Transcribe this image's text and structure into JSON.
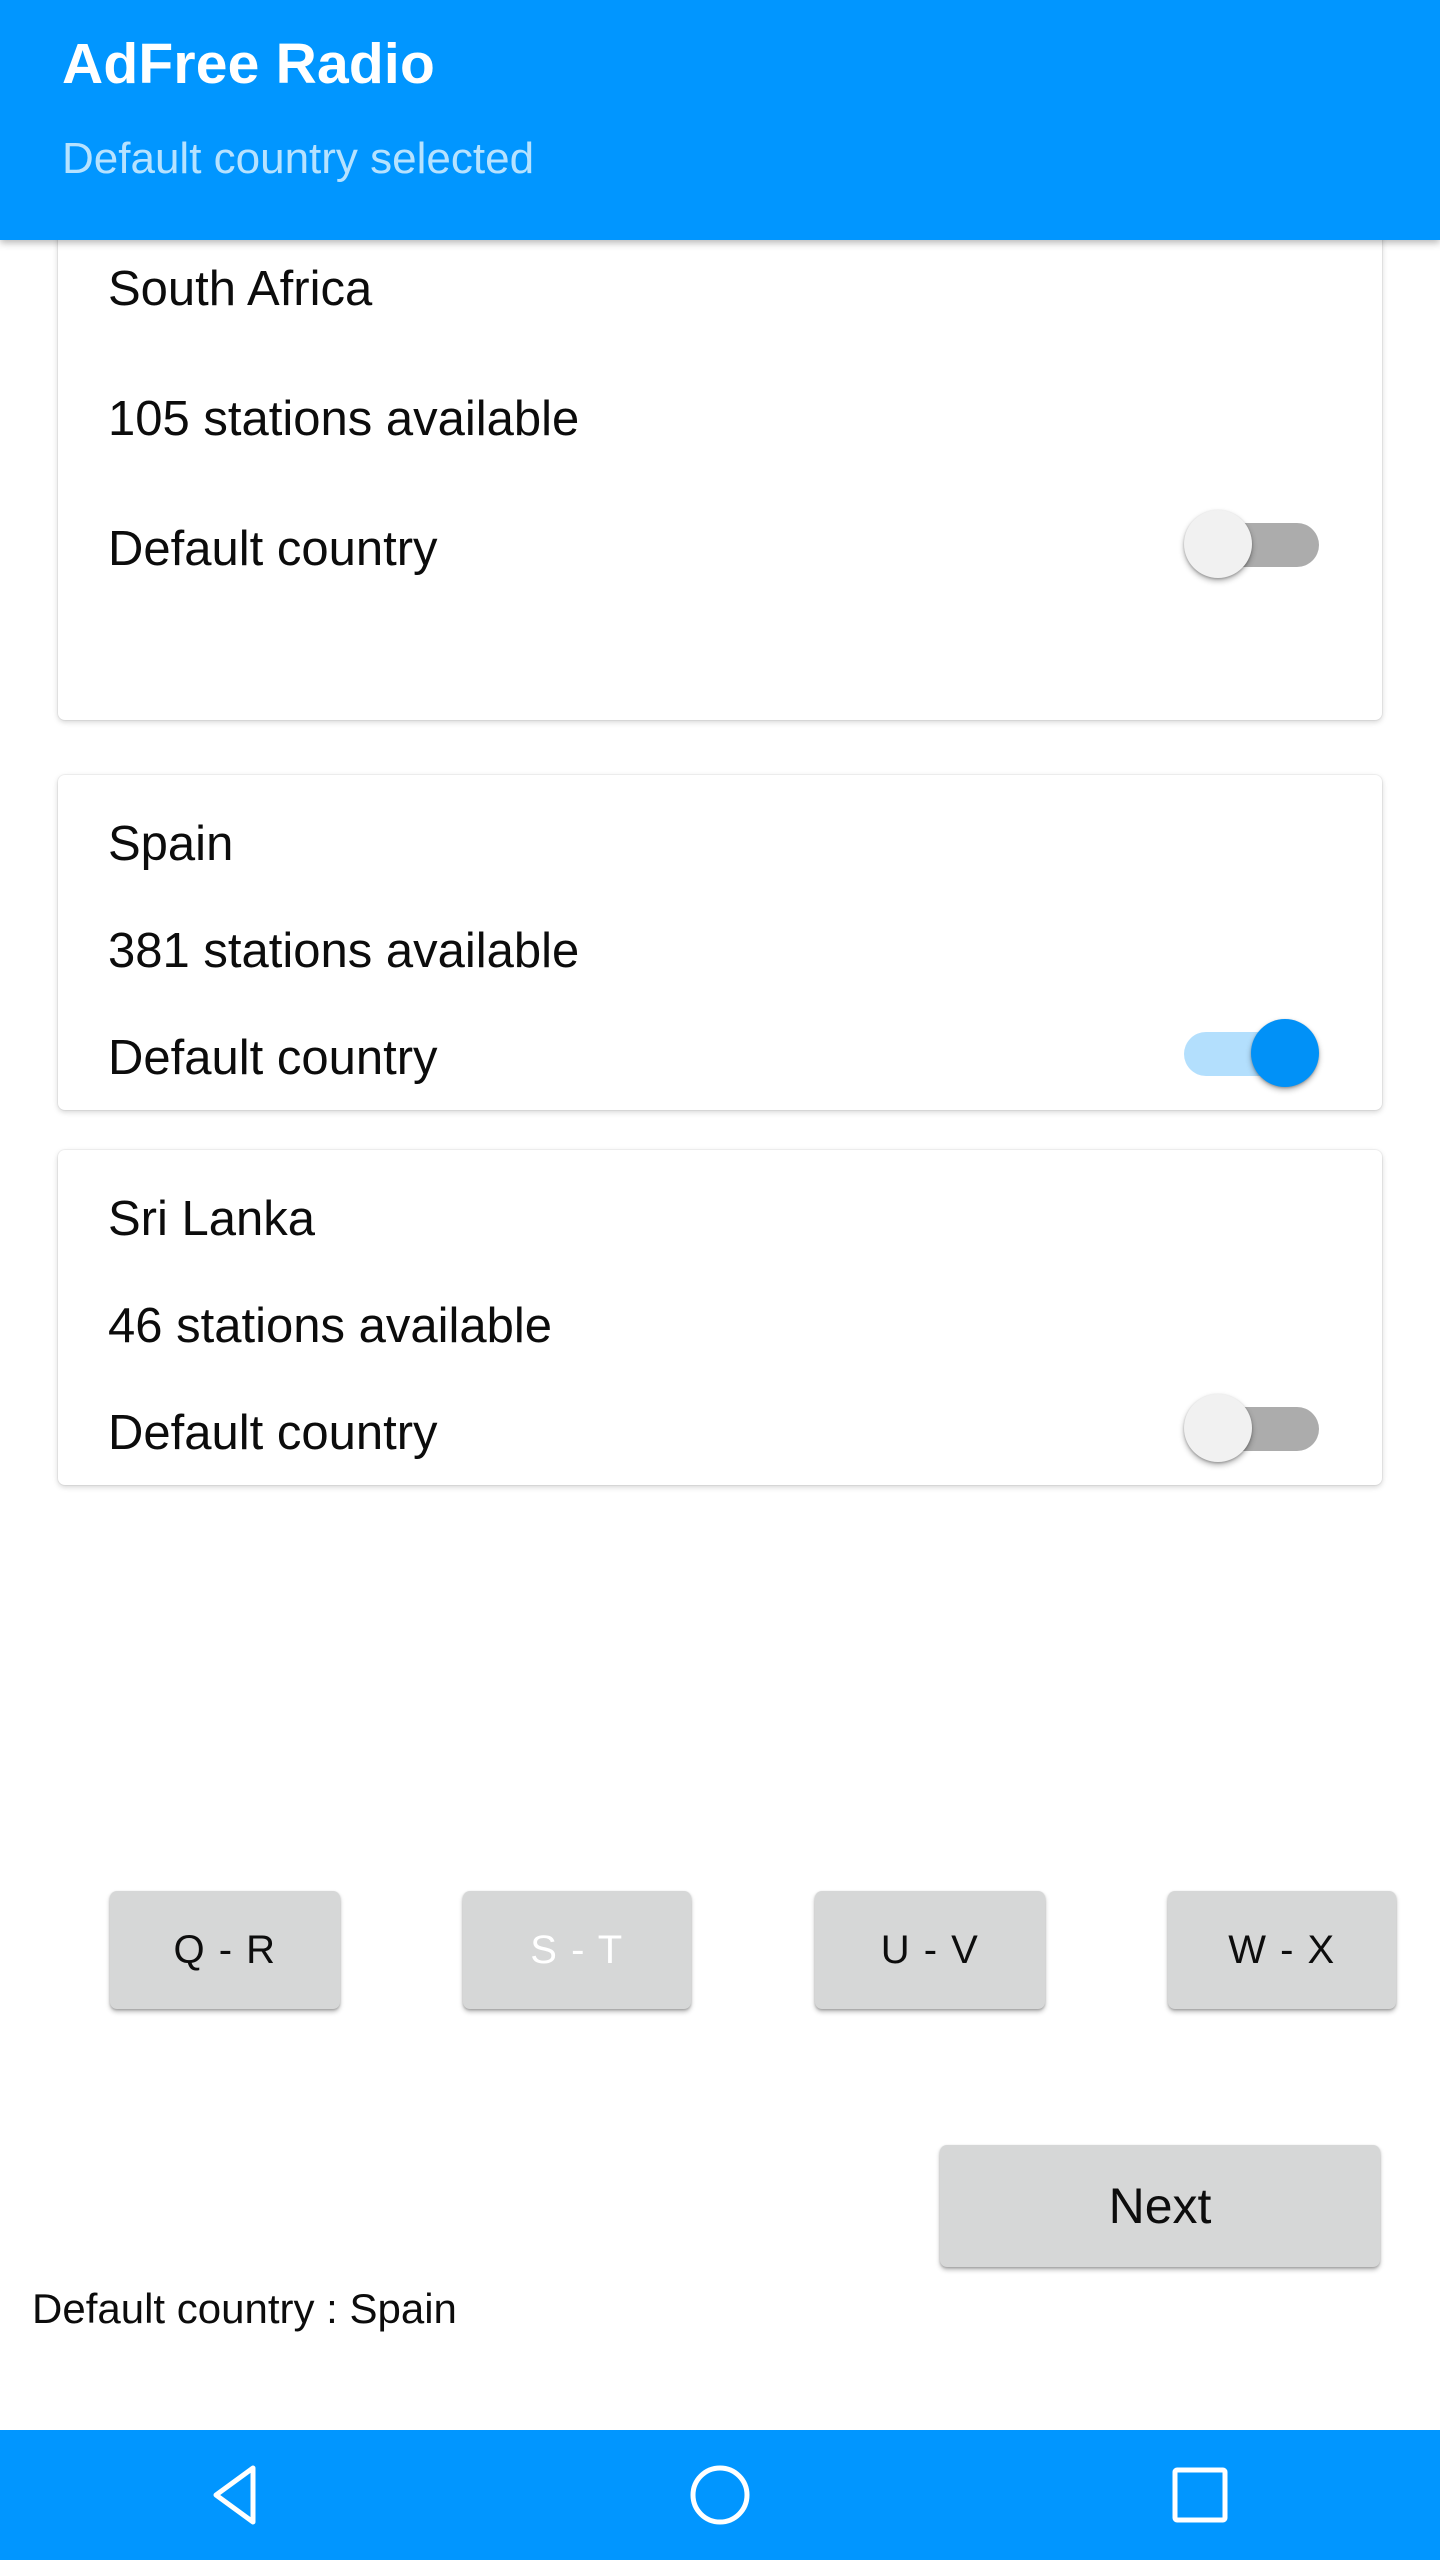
{
  "appbar": {
    "title": "AdFree Radio",
    "subtitle": "Default country selected",
    "background_color": "#0196FF",
    "subtitle_color": "#B6E2FF"
  },
  "country_cards": [
    {
      "name": "South Africa",
      "stations_text": "105 stations available",
      "stations_count": 105,
      "default_label": "Default country",
      "default_enabled": false,
      "clipped_top": true
    },
    {
      "name": "Spain",
      "stations_text": "381 stations available",
      "stations_count": 381,
      "default_label": "Default country",
      "default_enabled": true,
      "clipped_top": false
    },
    {
      "name": "Sri Lanka",
      "stations_text": "46 stations available",
      "stations_count": 46,
      "default_label": "Default country",
      "default_enabled": false,
      "clipped_top": false
    }
  ],
  "letter_buttons": [
    {
      "label": "Q - R",
      "selected": false
    },
    {
      "label": "S - T",
      "selected": true
    },
    {
      "label": "U - V",
      "selected": false
    },
    {
      "label": "W - X",
      "selected": false
    }
  ],
  "next_button": {
    "label": "Next"
  },
  "footer": {
    "status": "Default country : Spain"
  },
  "navbar": {
    "background_color": "#0196FF",
    "buttons": [
      {
        "icon": "back-triangle-icon",
        "name": "back"
      },
      {
        "icon": "home-circle-icon",
        "name": "home"
      },
      {
        "icon": "recents-square-icon",
        "name": "recents"
      }
    ]
  },
  "colors": {
    "accent_blue": "#0196FF",
    "switch_on_thumb": "#0191F7",
    "switch_on_track": "#B3DFFD",
    "switch_off_thumb": "#F1F1F1",
    "switch_off_track": "#ACACAC",
    "button_gray": "#D6D7D7"
  }
}
